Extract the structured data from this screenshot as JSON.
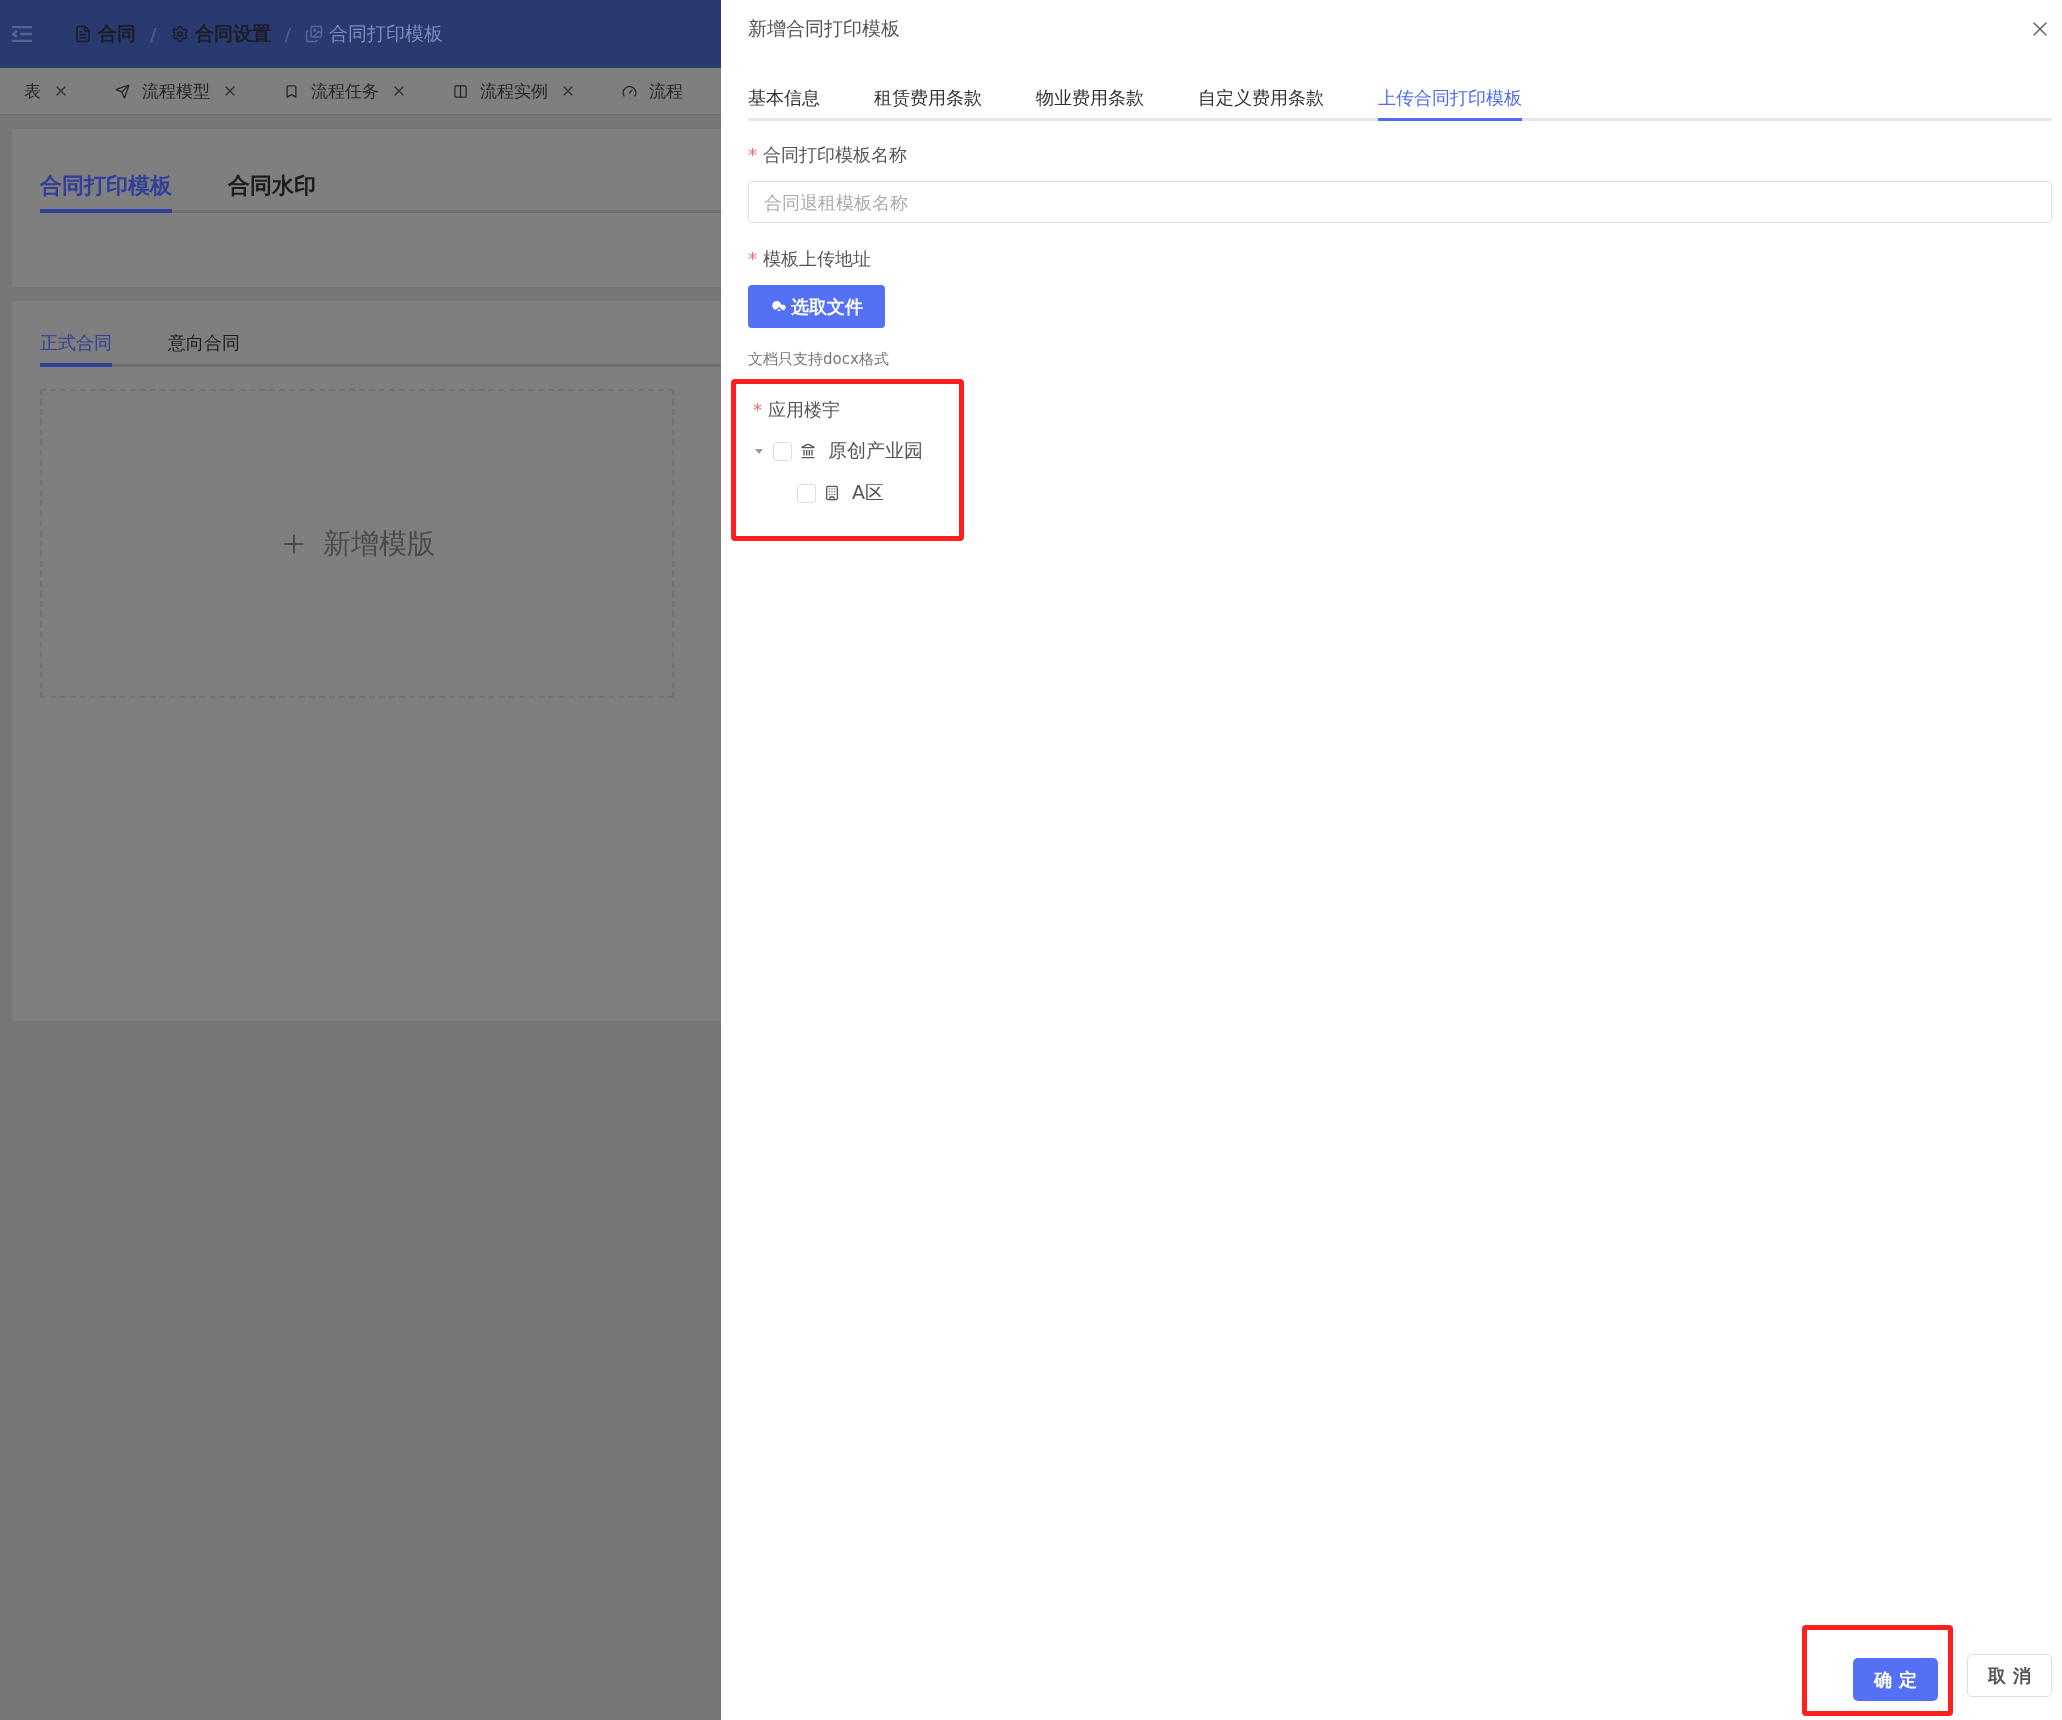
{
  "header": {
    "breadcrumb": [
      {
        "label": "合同",
        "current": false
      },
      {
        "label": "合同设置",
        "current": false
      },
      {
        "label": "合同打印模板",
        "current": true
      }
    ],
    "separator": "/"
  },
  "tag_bar": {
    "tags": [
      {
        "label": "表",
        "closable": true
      },
      {
        "label": "流程模型",
        "closable": true
      },
      {
        "label": "流程任务",
        "closable": true
      },
      {
        "label": "流程实例",
        "closable": true
      },
      {
        "label": "流程",
        "closable": false
      }
    ]
  },
  "page": {
    "main_tabs": [
      {
        "label": "合同打印模板",
        "selected": true
      },
      {
        "label": "合同水印",
        "selected": false
      }
    ],
    "sub_tabs": [
      {
        "label": "正式合同",
        "selected": true
      },
      {
        "label": "意向合同",
        "selected": false
      }
    ],
    "add_card": {
      "label": "新增模版"
    }
  },
  "drawer": {
    "title": "新增合同打印模板",
    "tabs": [
      {
        "label": "基本信息",
        "selected": false
      },
      {
        "label": "租赁费用条款",
        "selected": false
      },
      {
        "label": "物业费用条款",
        "selected": false
      },
      {
        "label": "自定义费用条款",
        "selected": false
      },
      {
        "label": "上传合同打印模板",
        "selected": true
      }
    ],
    "fields": [
      {
        "kind": "input",
        "label": "合同打印模板名称",
        "required_mark": "*",
        "placeholder": "合同退租模板名称"
      },
      {
        "kind": "upload",
        "label": "模板上传地址",
        "required_mark": "*",
        "button": "选取文件",
        "hint": "文档只支持docx格式"
      },
      {
        "kind": "tree",
        "label": "应用楼宇",
        "required_mark": "*",
        "highlighted": true,
        "nodes": [
          {
            "label": "原创产业园",
            "checked": false,
            "expanded": true,
            "children": [
              {
                "label": "A区",
                "checked": false
              }
            ]
          }
        ]
      }
    ],
    "footer": {
      "confirm": {
        "label": "确 定",
        "highlighted": true
      },
      "cancel": {
        "label": "取 消"
      }
    }
  }
}
